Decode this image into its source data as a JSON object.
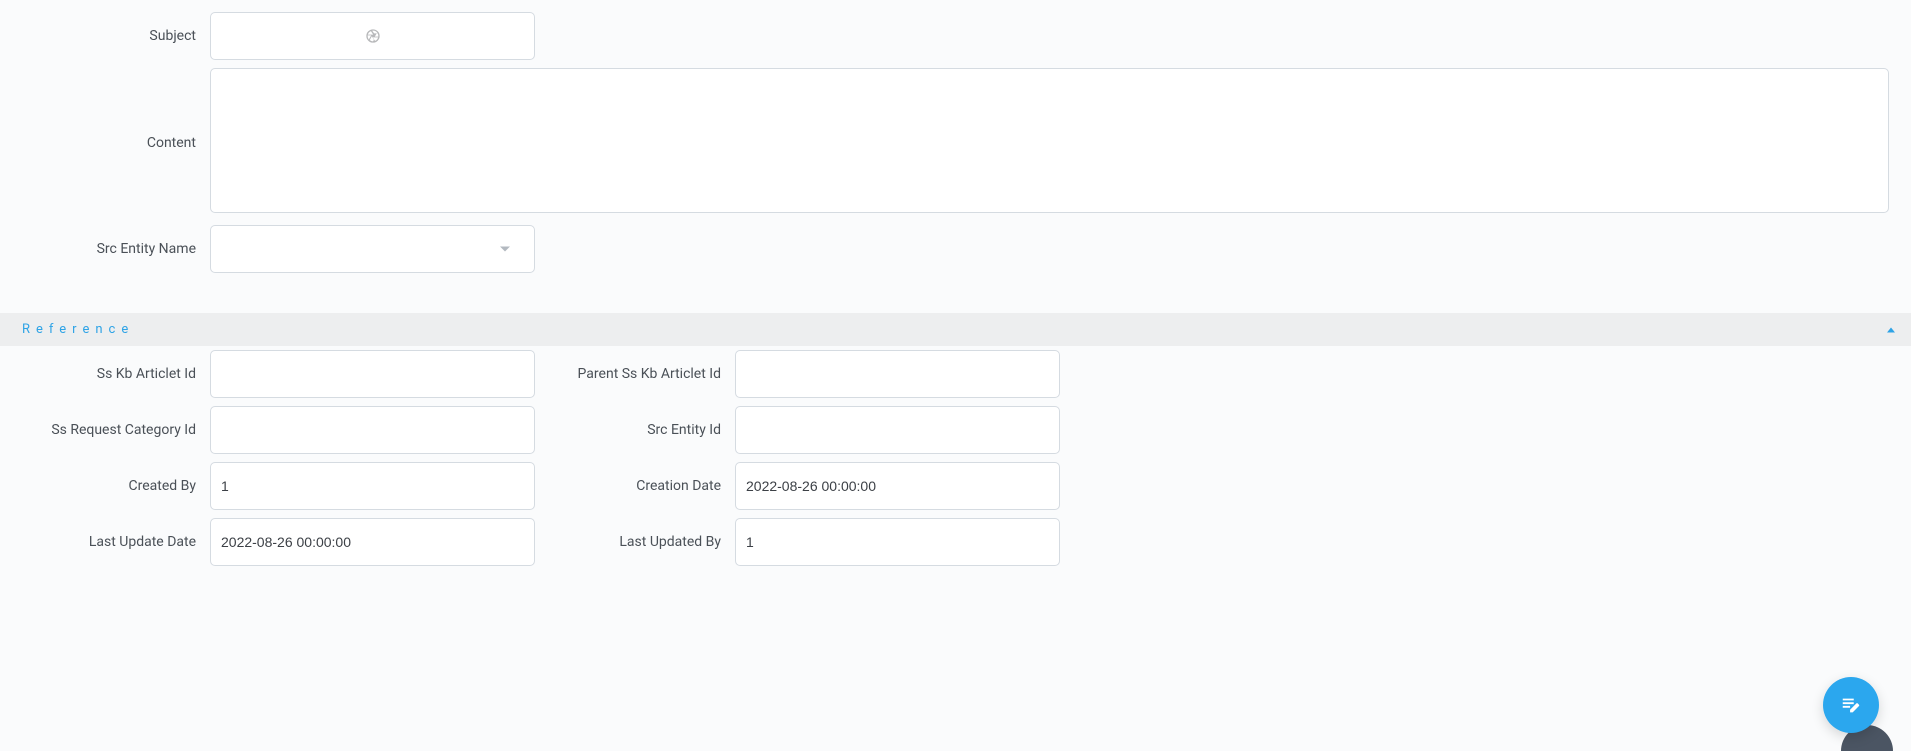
{
  "top": {
    "subject_label": "Subject",
    "content_label": "Content",
    "src_entity_name_label": "Src Entity Name",
    "subject_value": "",
    "content_value": "",
    "src_entity_name_value": ""
  },
  "section": {
    "title": "Reference"
  },
  "ref": {
    "ss_kb_articlet_id_label": "Ss Kb Articlet Id",
    "ss_kb_articlet_id_value": "",
    "parent_ss_kb_articlet_id_label": "Parent Ss Kb Articlet Id",
    "parent_ss_kb_articlet_id_value": "",
    "ss_request_category_id_label": "Ss Request Category Id",
    "ss_request_category_id_value": "",
    "src_entity_id_label": "Src Entity Id",
    "src_entity_id_value": "",
    "created_by_label": "Created By",
    "created_by_value": "1",
    "creation_date_label": "Creation Date",
    "creation_date_value": "2022-08-26 00:00:00",
    "last_update_date_label": "Last Update Date",
    "last_update_date_value": "2022-08-26 00:00:00",
    "last_updated_by_label": "Last Updated By",
    "last_updated_by_value": "1"
  }
}
